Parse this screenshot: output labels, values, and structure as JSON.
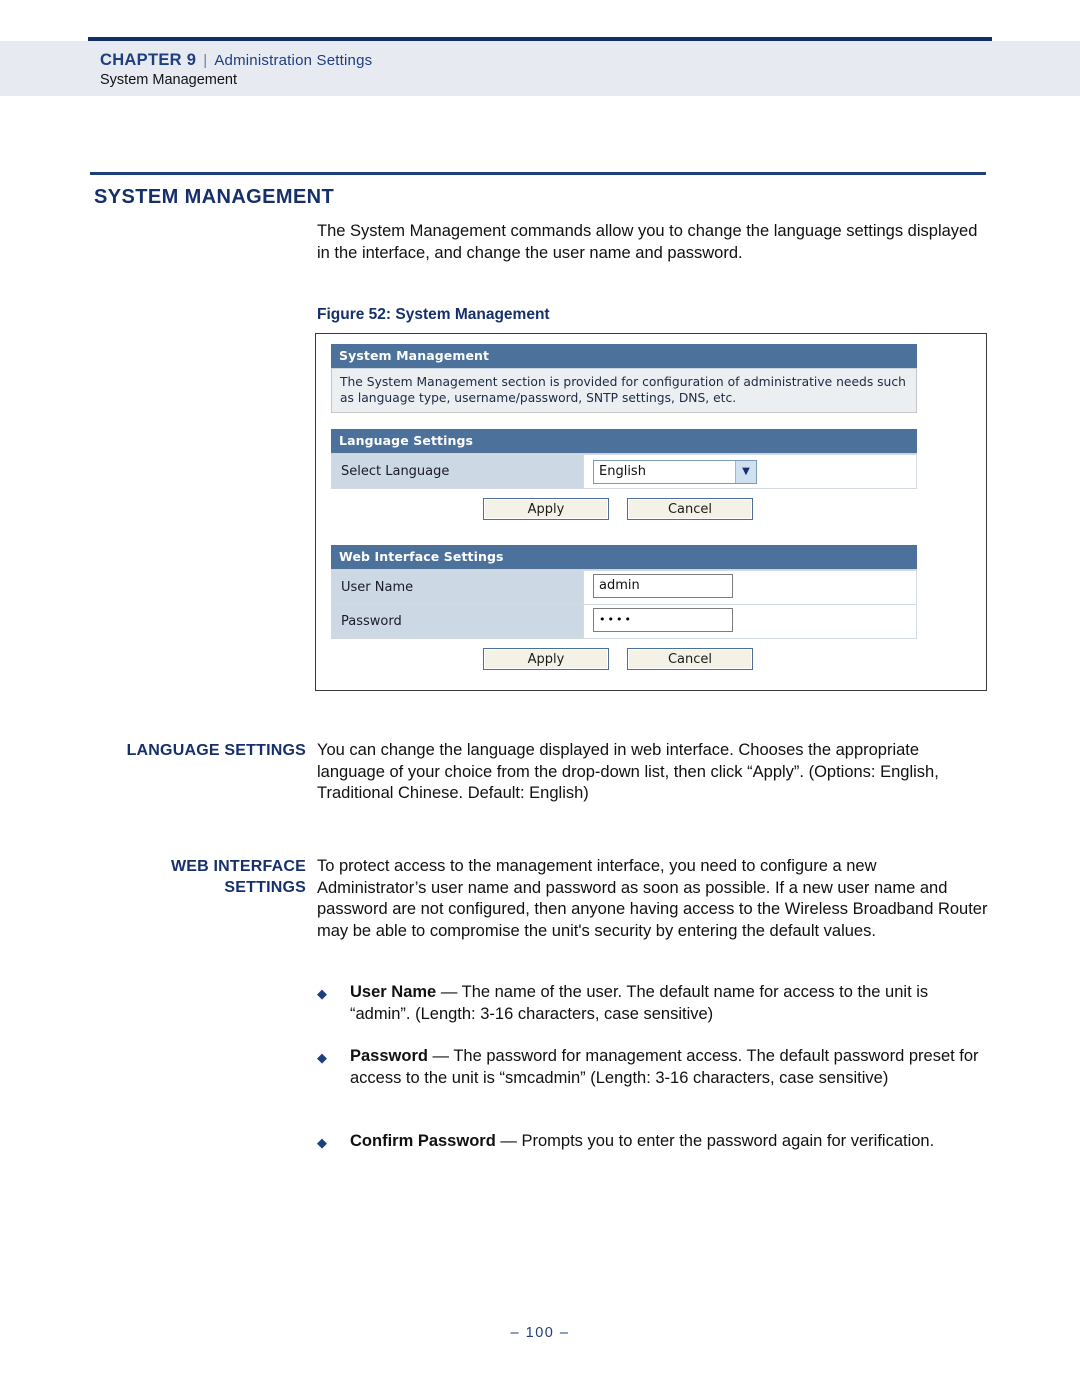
{
  "header": {
    "chapter": "CHAPTER 9",
    "separator": "|",
    "chapter_title": "Administration Settings",
    "running_title": "System Management"
  },
  "section": {
    "title": "SYSTEM MANAGEMENT",
    "intro": "The System Management commands allow you to change the language settings displayed in the interface, and change the user name and password.",
    "figure_caption": "Figure 52:  System Management"
  },
  "figure": {
    "panels": {
      "system_management": {
        "bar_title": "System Management",
        "description": "The System Management section is provided for configuration of administrative needs such as language type, username/password, SNTP settings, DNS, etc."
      },
      "language_settings": {
        "bar_title": "Language Settings",
        "row_label": "Select Language",
        "selected_value": "English",
        "dropdown_arrow": "chevron-down-icon",
        "apply_label": "Apply",
        "cancel_label": "Cancel"
      },
      "web_interface_settings": {
        "bar_title": "Web Interface Settings",
        "username_label": "User Name",
        "username_value": "admin",
        "password_label": "Password",
        "password_value": "••••",
        "apply_label": "Apply",
        "cancel_label": "Cancel"
      }
    },
    "colors": {
      "panel_bar": "#4c719b",
      "label_cell": "#ccd8e4",
      "description_bg": "#eceff2",
      "button_face": "#f4f2e6",
      "button_border": "#4c6f9c"
    }
  },
  "language_settings_section": {
    "side_heading": "LANGUAGE SETTINGS",
    "body": "You can change the language displayed in web interface. Chooses the appropriate language of your choice from the drop-down list, then click “Apply”. (Options: English, Traditional Chinese. Default: English)"
  },
  "web_interface_section": {
    "side_heading_line1": "WEB INTERFACE",
    "side_heading_line2": "SETTINGS",
    "body": "To protect access to the management interface, you need to configure a new Administrator’s user name and password as soon as possible. If a new user name and password are not configured, then anyone having access to the Wireless Broadband Router may be able to compromise the unit's security by entering the default values.",
    "bullets": [
      {
        "glyph": "◆",
        "term": "User Name",
        "dash": "—",
        "text": "The name of the user. The default name for access to the unit is “admin”. (Length: 3-16 characters, case sensitive)"
      },
      {
        "glyph": "◆",
        "term": "Password",
        "dash": "—",
        "text": "The password for management access. The default password preset for access to the unit is “smcadmin” (Length: 3-16 characters, case sensitive)"
      },
      {
        "glyph": "◆",
        "term": "Confirm Password",
        "dash": "—",
        "text": "Prompts you to enter the password again for verification."
      }
    ]
  },
  "footer": {
    "page_number": "–  100  –"
  },
  "theme": {
    "navy": "#16306b",
    "rule": "#1d3f7d",
    "header_band": "#e7eaf1"
  }
}
